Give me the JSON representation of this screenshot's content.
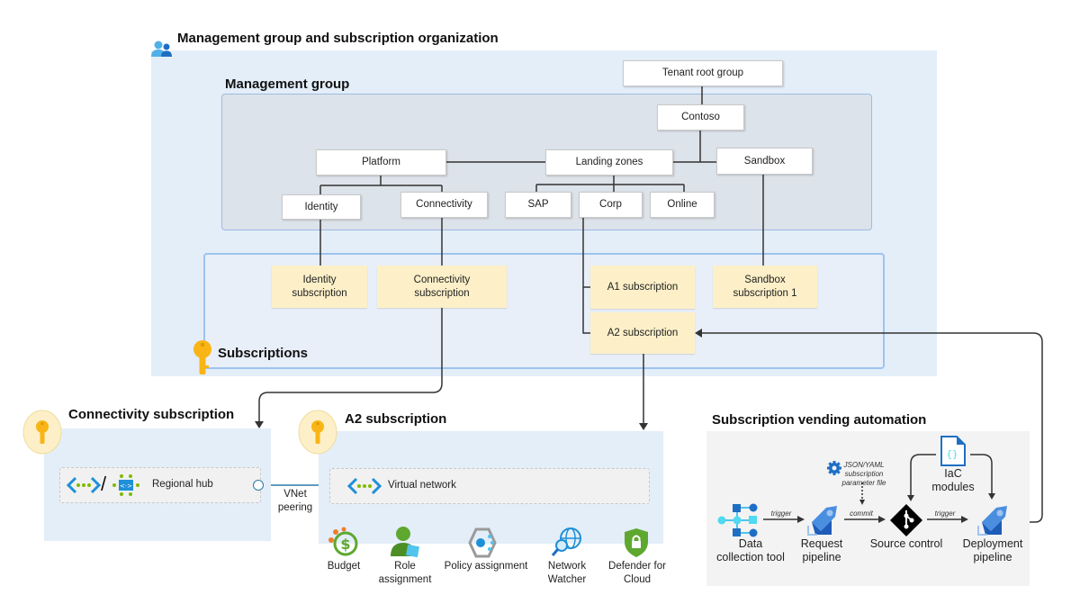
{
  "org": {
    "title": "Management group and subscription organization",
    "management_group_title": "Management group",
    "subscriptions_title": "Subscriptions",
    "nodes": {
      "tenant_root": "Tenant root group",
      "contoso": "Contoso",
      "platform": "Platform",
      "landing_zones": "Landing zones",
      "sandbox": "Sandbox",
      "identity": "Identity",
      "connectivity": "Connectivity",
      "sap": "SAP",
      "corp": "Corp",
      "online": "Online"
    },
    "subscriptions": {
      "identity_line1": "Identity",
      "identity_line2": "subscription",
      "connectivity_line1": "Connectivity",
      "connectivity_line2": "subscription",
      "a1": "A1 subscription",
      "a2": "A2 subscription",
      "sandbox_line1": "Sandbox",
      "sandbox_line2": "subscription 1"
    }
  },
  "connectivity_sub": {
    "title": "Connectivity subscription",
    "hub_label": "Regional hub",
    "separator": "/",
    "peering_line1": "VNet",
    "peering_line2": "peering"
  },
  "a2_sub": {
    "title": "A2 subscription",
    "vnet_label": "Virtual network",
    "resources": [
      {
        "icon": "budget-icon",
        "line1": "Budget",
        "line2": ""
      },
      {
        "icon": "role-assignment-icon",
        "line1": "Role",
        "line2": "assignment"
      },
      {
        "icon": "policy-assignment-icon",
        "line1": "Policy assignment",
        "line2": ""
      },
      {
        "icon": "network-watcher-icon",
        "line1": "Network",
        "line2": "Watcher"
      },
      {
        "icon": "defender-icon",
        "line1": "Defender for",
        "line2": "Cloud"
      }
    ]
  },
  "vending": {
    "title": "Subscription vending automation",
    "data_collection_line1": "Data",
    "data_collection_line2": "collection tool",
    "request_line1": "Request",
    "request_line2": "pipeline",
    "source_control": "Source control",
    "deployment_line1": "Deployment",
    "deployment_line2": "pipeline",
    "iac_line1": "IaC",
    "iac_line2": "modules",
    "param_line1": "JSON/YAML",
    "param_line2": "subscription",
    "param_line3": "parameter file",
    "edge_trigger1": "trigger",
    "edge_commit": "commit",
    "edge_trigger2": "trigger"
  },
  "colors": {
    "outer_panel": "#e3eef9",
    "mg_panel": "#dde3ea",
    "subscription_fill": "#fdf0c8",
    "accent_blue": "#0078d4",
    "key_yellow": "#f9b516"
  }
}
